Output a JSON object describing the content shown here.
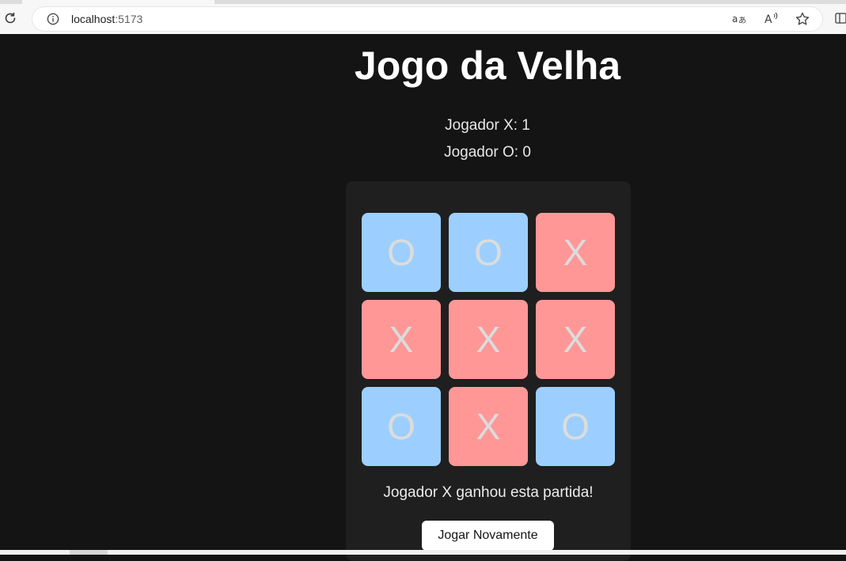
{
  "browser": {
    "url_host": "localhost",
    "url_port": ":5173",
    "icons": [
      "reload-icon",
      "info-icon",
      "translate-icon",
      "read-aloud-icon",
      "favorite-star-icon",
      "split-screen-icon"
    ]
  },
  "game": {
    "title": "Jogo da Velha",
    "score_x": "Jogador X: 1",
    "score_o": "Jogador O: 0",
    "board": [
      "O",
      "O",
      "X",
      "X",
      "X",
      "X",
      "O",
      "X",
      "O"
    ],
    "result_message": "Jogador X ganhou esta partida!",
    "play_again_label": "Jogar Novamente"
  },
  "colors": {
    "background": "#141414",
    "panel": "#1f1f1f",
    "x_cell": "#ff9797",
    "o_cell": "#9ccfff",
    "mark_text": "#dcdcdc"
  }
}
